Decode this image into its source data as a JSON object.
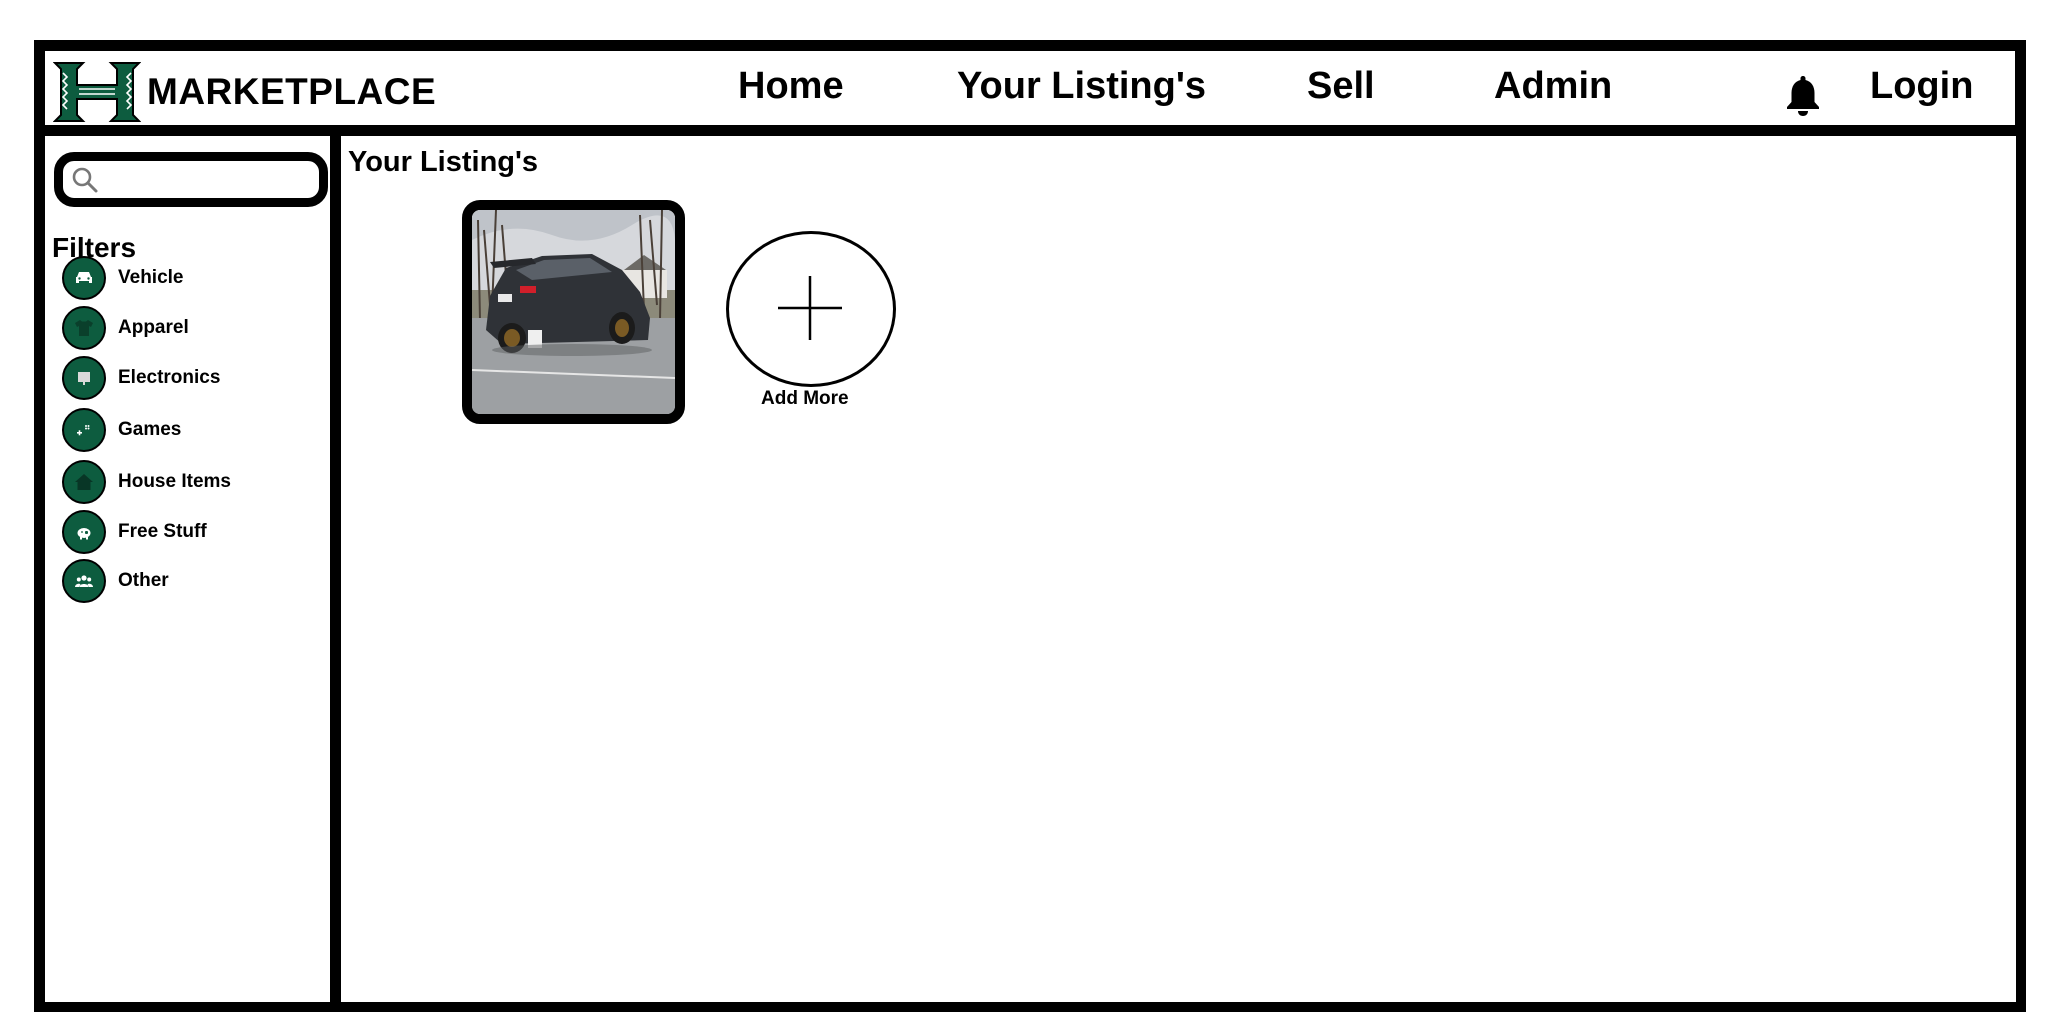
{
  "header": {
    "brand": "MARKETPLACE",
    "nav": [
      "Home",
      "Your Listing's",
      "Sell",
      "Admin"
    ],
    "login": "Login",
    "notification_icon": "bell-icon"
  },
  "sidebar": {
    "search": {
      "value": "",
      "placeholder": "",
      "icon": "search-icon"
    },
    "filters_title": "Filters",
    "filters": [
      {
        "label": "Vehicle",
        "icon": "car-icon"
      },
      {
        "label": "Apparel",
        "icon": "shirt-icon"
      },
      {
        "label": "Electronics",
        "icon": "monitor-icon"
      },
      {
        "label": "Games",
        "icon": "gamepad-icon"
      },
      {
        "label": "House Items",
        "icon": "house-icon"
      },
      {
        "label": "Free Stuff",
        "icon": "piggy-bank-icon"
      },
      {
        "label": "Other",
        "icon": "group-icon"
      }
    ]
  },
  "main": {
    "title": "Your Listing's",
    "listings": [
      {
        "image": "car-photo"
      }
    ],
    "add_more_label": "Add More"
  },
  "colors": {
    "brand_green": "#0d5c3f",
    "border": "#000000",
    "background": "#ffffff"
  }
}
